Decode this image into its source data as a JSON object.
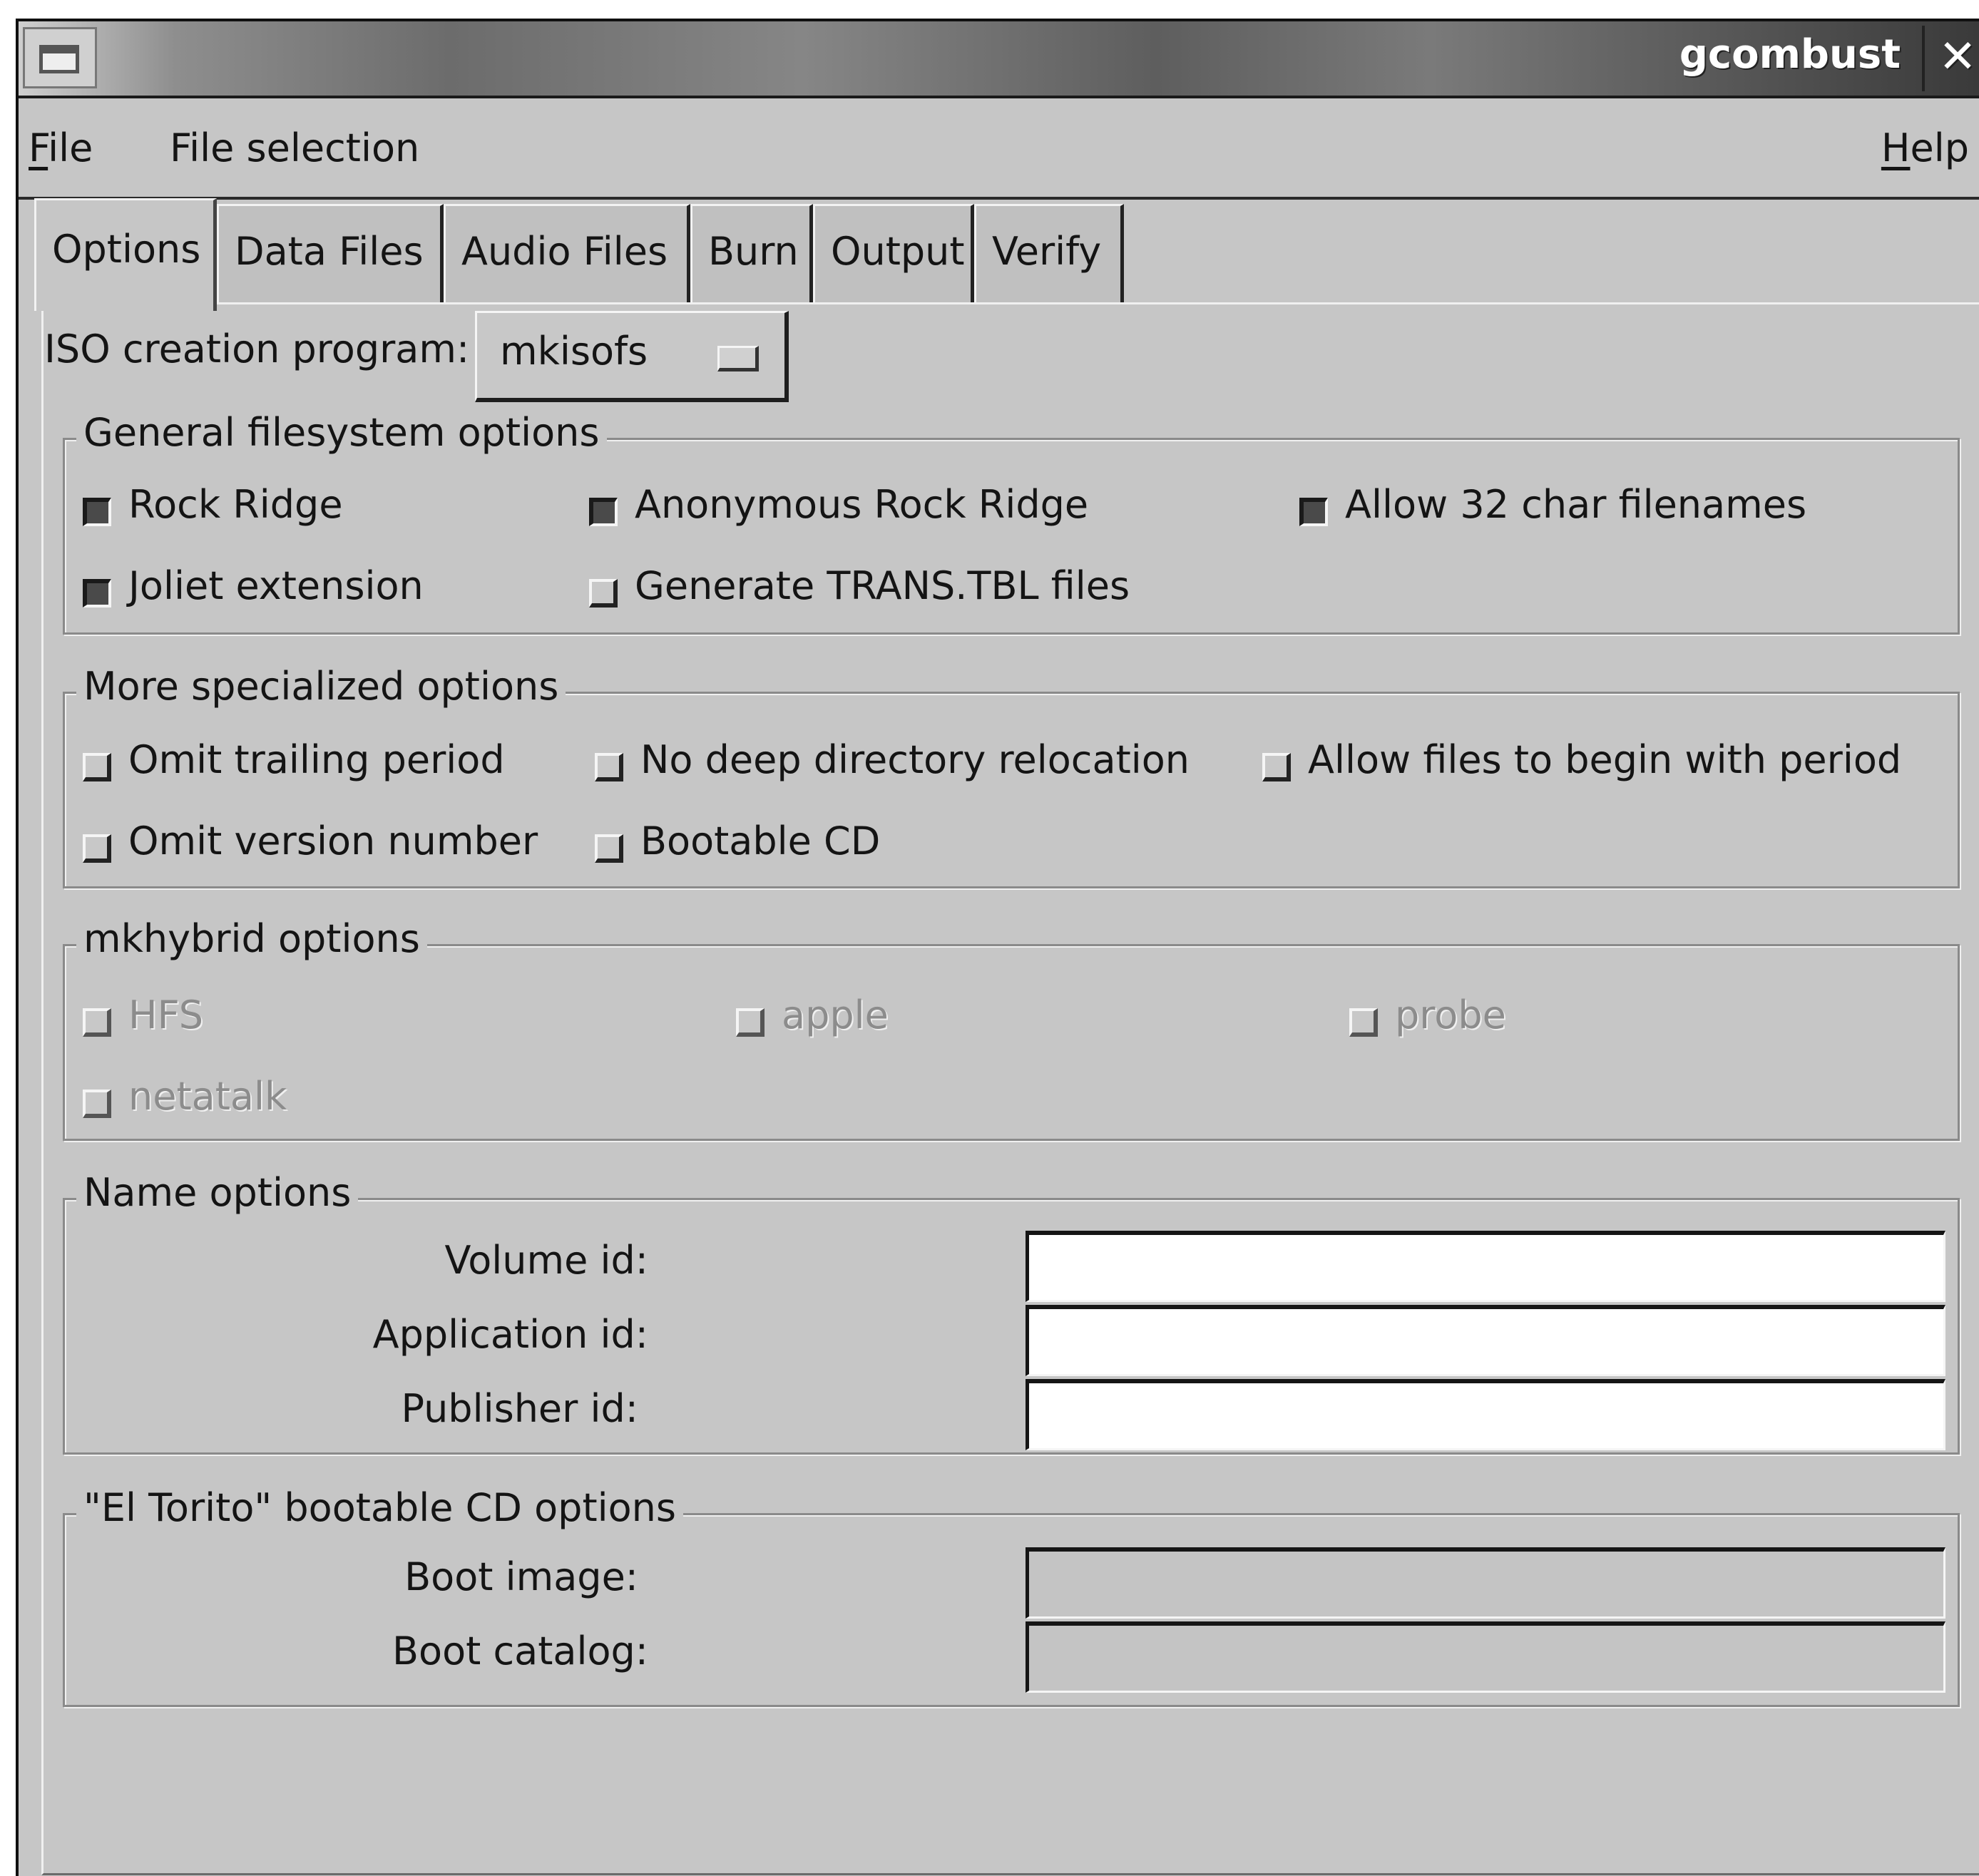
{
  "window": {
    "title": "gcombust"
  },
  "menubar": {
    "file": {
      "accel": "F",
      "rest": "ile"
    },
    "file_selection": "File selection",
    "help": {
      "accel": "H",
      "rest": "elp"
    }
  },
  "tabs": [
    "Options",
    "Data Files",
    "Audio Files",
    "Burn",
    "Output",
    "Verify"
  ],
  "iso": {
    "label": "ISO creation program:",
    "value": "mkisofs"
  },
  "general": {
    "title": "General filesystem options",
    "rock_ridge": "Rock Ridge",
    "anonymous_rock_ridge": "Anonymous Rock Ridge",
    "allow_32": "Allow 32 char filenames",
    "joliet": "Joliet extension",
    "trans_tbl": "Generate TRANS.TBL files"
  },
  "specialized": {
    "title": "More specialized options",
    "omit_trailing": "Omit trailing period",
    "no_deep": "No deep directory relocation",
    "allow_period": "Allow files to begin with period",
    "omit_version": "Omit version number",
    "bootable": "Bootable CD"
  },
  "mkhybrid": {
    "title": "mkhybrid options",
    "hfs": "HFS",
    "apple": "apple",
    "probe": "probe",
    "netatalk": "netatalk"
  },
  "names": {
    "title": "Name options",
    "volume_label": "Volume id:",
    "application_label": "Application id:",
    "publisher_label": "Publisher id:",
    "volume_value": "",
    "application_value": "",
    "publisher_value": ""
  },
  "eltorito": {
    "title": "\"El Torito\" bootable CD options",
    "boot_image_label": "Boot image:",
    "boot_catalog_label": "Boot catalog:"
  }
}
